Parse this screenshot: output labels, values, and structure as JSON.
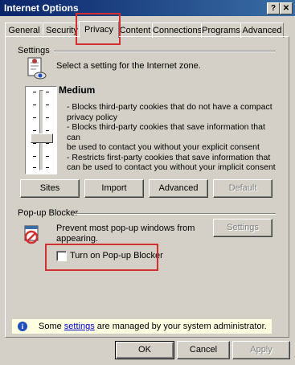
{
  "window": {
    "title": "Internet Options",
    "help_glyph": "?",
    "close_glyph": "✕"
  },
  "tabs": [
    {
      "label": "General"
    },
    {
      "label": "Security"
    },
    {
      "label": "Privacy"
    },
    {
      "label": "Content"
    },
    {
      "label": "Connections"
    },
    {
      "label": "Programs"
    },
    {
      "label": "Advanced"
    }
  ],
  "settings": {
    "group_label": "Settings",
    "intro_text": "Select a setting for the Internet zone.",
    "level_title": "Medium",
    "description_lines": [
      "- Blocks third-party cookies that do not have a compact",
      "privacy policy",
      "- Blocks third-party cookies that save information that can",
      "be used to contact you without your explicit consent",
      "- Restricts first-party cookies that save information that",
      "can be used to contact you without your implicit consent"
    ],
    "buttons": {
      "sites": "Sites",
      "import": "Import",
      "advanced": "Advanced",
      "default": "Default"
    }
  },
  "popup_blocker": {
    "group_label": "Pop-up Blocker",
    "description_line1": "Prevent most pop-up windows from",
    "description_line2": "appearing.",
    "settings_button": "Settings",
    "checkbox_label": "Turn on Pop-up Blocker",
    "checked": false
  },
  "info_bar": {
    "before_link": "Some ",
    "link": "settings",
    "after_link": " are managed by your system administrator."
  },
  "footer": {
    "ok": "OK",
    "cancel": "Cancel",
    "apply": "Apply"
  },
  "colors": {
    "title_bar": "#0a246a",
    "dialog_bg": "#d4d0c8",
    "highlight_red": "#d23030",
    "info_bg": "#ffffe1",
    "info_icon": "#1f4fbf"
  }
}
